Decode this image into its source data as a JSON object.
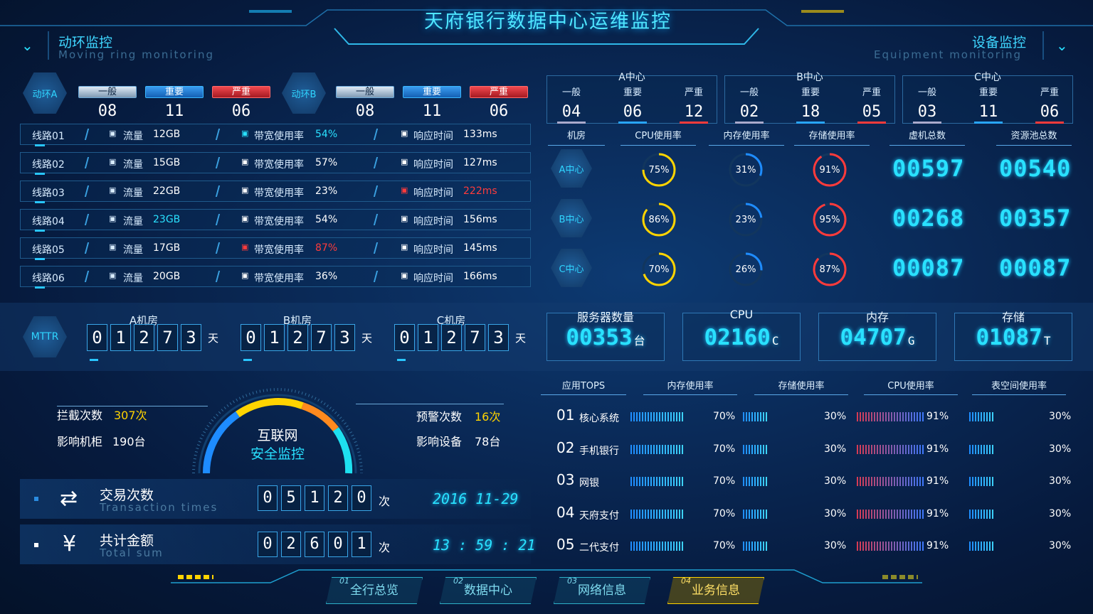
{
  "title": "天府银行数据中心运维监控",
  "left_section": {
    "title": "动环监控",
    "subtitle": "Moving ring monitoring"
  },
  "right_section": {
    "title": "设备监控",
    "subtitle": "Equipment monitoring"
  },
  "ring_a": {
    "name": "动环A",
    "general": "一般",
    "important": "重要",
    "severe": "严重",
    "v_general": "08",
    "v_important": "11",
    "v_severe": "06"
  },
  "ring_b": {
    "name": "动环B",
    "general": "一般",
    "important": "重要",
    "severe": "严重",
    "v_general": "08",
    "v_important": "11",
    "v_severe": "06"
  },
  "lines": [
    {
      "name": "线路01",
      "flow_label": "流量",
      "flow": "12GB",
      "bw_label": "带宽使用率",
      "bw": "54%",
      "rt_label": "响应时间",
      "rt": "133ms"
    },
    {
      "name": "线路02",
      "flow_label": "流量",
      "flow": "15GB",
      "bw_label": "带宽使用率",
      "bw": "57%",
      "rt_label": "响应时间",
      "rt": "127ms"
    },
    {
      "name": "线路03",
      "flow_label": "流量",
      "flow": "22GB",
      "bw_label": "带宽使用率",
      "bw": "23%",
      "rt_label": "响应时间",
      "rt": "222ms"
    },
    {
      "name": "线路04",
      "flow_label": "流量",
      "flow": "23GB",
      "bw_label": "带宽使用率",
      "bw": "54%",
      "rt_label": "响应时间",
      "rt": "156ms"
    },
    {
      "name": "线路05",
      "flow_label": "流量",
      "flow": "17GB",
      "bw_label": "带宽使用率",
      "bw": "87%",
      "rt_label": "响应时间",
      "rt": "145ms"
    },
    {
      "name": "线路06",
      "flow_label": "流量",
      "flow": "20GB",
      "bw_label": "带宽使用率",
      "bw": "36%",
      "rt_label": "响应时间",
      "rt": "166ms"
    }
  ],
  "centers": [
    {
      "name": "A中心",
      "general": "一般",
      "important": "重要",
      "severe": "严重",
      "v1": "04",
      "v2": "06",
      "v3": "12"
    },
    {
      "name": "B中心",
      "general": "一般",
      "important": "重要",
      "severe": "严重",
      "v1": "02",
      "v2": "18",
      "v3": "05"
    },
    {
      "name": "C中心",
      "general": "一般",
      "important": "重要",
      "severe": "严重",
      "v1": "03",
      "v2": "11",
      "v3": "06"
    }
  ],
  "equip_headers": {
    "room": "机房",
    "cpu": "CPU使用率",
    "mem": "内存使用率",
    "storage": "存储使用率",
    "vm": "虚机总数",
    "pool": "资源池总数"
  },
  "equip_rows": [
    {
      "room": "A中心",
      "cpu": "75%",
      "mem": "31%",
      "storage": "91%",
      "vm": "00597",
      "pool": "00540"
    },
    {
      "room": "B中心",
      "cpu": "86%",
      "mem": "23%",
      "storage": "95%",
      "vm": "00268",
      "pool": "00357"
    },
    {
      "room": "C中心",
      "cpu": "70%",
      "mem": "26%",
      "storage": "87%",
      "vm": "00087",
      "pool": "00087"
    }
  ],
  "gauge_levels": {
    "cpu": [
      0.75,
      0.86,
      0.7
    ],
    "mem": [
      0.31,
      0.23,
      0.26
    ],
    "storage": [
      0.91,
      0.95,
      0.87
    ]
  },
  "mttr": {
    "label": "MTTR",
    "unit": "天",
    "rooms": [
      {
        "name": "A机房",
        "digits": [
          "0",
          "1",
          "2",
          "7",
          "3"
        ]
      },
      {
        "name": "B机房",
        "digits": [
          "0",
          "1",
          "2",
          "7",
          "3"
        ]
      },
      {
        "name": "C机房",
        "digits": [
          "0",
          "1",
          "2",
          "7",
          "3"
        ]
      }
    ]
  },
  "metrics": [
    {
      "title": "服务器数量",
      "value": "00353",
      "unit": "台"
    },
    {
      "title": "CPU",
      "value": "02160",
      "unit": "C"
    },
    {
      "title": "内存",
      "value": "04707",
      "unit": "G"
    },
    {
      "title": "存储",
      "value": "01087",
      "unit": "T"
    }
  ],
  "security": {
    "title": "互联网",
    "subtitle": "安全监控",
    "intercept_label": "拦截次数",
    "intercept": "307次",
    "cabinet_label": "影响机柜",
    "cabinet": "190台",
    "warn_label": "预警次数",
    "warn": "16次",
    "device_label": "影响设备",
    "device": "78台"
  },
  "transaction": {
    "title": "交易次数",
    "subtitle": "Transaction times",
    "digits": [
      "0",
      "5",
      "1",
      "2",
      "0"
    ],
    "unit": "次",
    "date": "2016 11-29"
  },
  "total": {
    "title": "共计金额",
    "subtitle": "Total sum",
    "digits": [
      "0",
      "2",
      "6",
      "0",
      "1"
    ],
    "unit": "次",
    "time": "13 : 59 : 21"
  },
  "tops": {
    "headers": [
      "应用TOPS",
      "内存使用率",
      "存储使用率",
      "CPU使用率",
      "表空间使用率"
    ],
    "rows": [
      {
        "rank": "01",
        "name": "核心系统",
        "mem": "70%",
        "storage": "30%",
        "cpu": "91%",
        "space": "30%"
      },
      {
        "rank": "02",
        "name": "手机银行",
        "mem": "70%",
        "storage": "30%",
        "cpu": "91%",
        "space": "30%"
      },
      {
        "rank": "03",
        "name": "网银",
        "mem": "70%",
        "storage": "30%",
        "cpu": "91%",
        "space": "30%"
      },
      {
        "rank": "04",
        "name": "天府支付",
        "mem": "70%",
        "storage": "30%",
        "cpu": "91%",
        "space": "30%"
      },
      {
        "rank": "05",
        "name": "二代支付",
        "mem": "70%",
        "storage": "30%",
        "cpu": "91%",
        "space": "30%"
      }
    ]
  },
  "nav": [
    {
      "no": "01",
      "label": "全行总览"
    },
    {
      "no": "02",
      "label": "数据中心"
    },
    {
      "no": "03",
      "label": "网络信息"
    },
    {
      "no": "04",
      "label": "业务信息",
      "active": true
    }
  ],
  "colors": {
    "accent": "#29e1ff",
    "warning": "#ffd400",
    "danger": "#ff3b3b",
    "orange": "#ff8a1e"
  }
}
